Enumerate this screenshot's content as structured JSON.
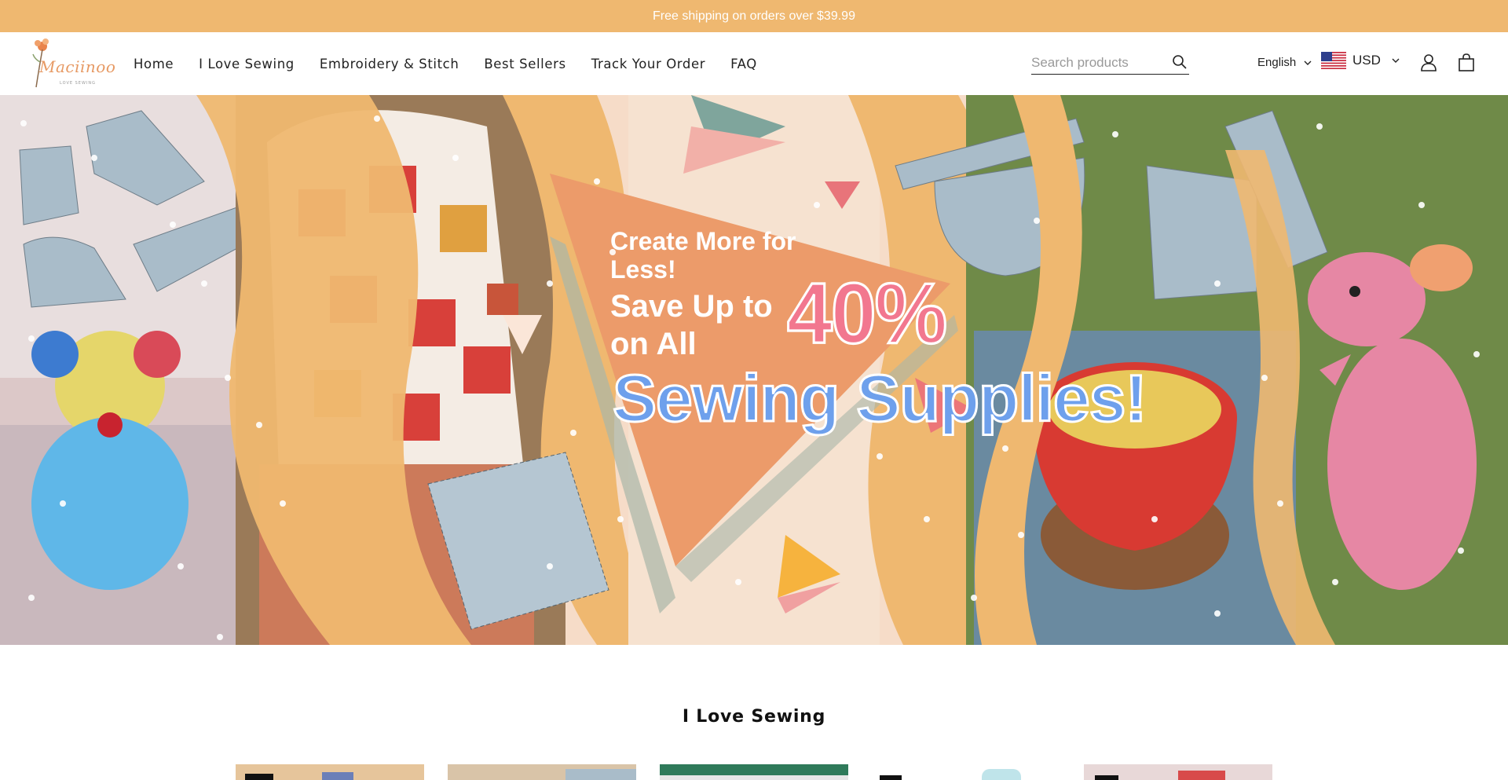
{
  "announcement": {
    "text": "Free shipping on orders over $39.99"
  },
  "header": {
    "logo": {
      "name": "Maciinoo",
      "tagline": "LOVE SEWING"
    },
    "nav": [
      {
        "label": "Home"
      },
      {
        "label": "I Love Sewing"
      },
      {
        "label": "Embroidery & Stitch"
      },
      {
        "label": "Best Sellers"
      },
      {
        "label": "Track Your Order"
      },
      {
        "label": "FAQ"
      }
    ],
    "search": {
      "placeholder": "Search products",
      "value": ""
    },
    "language": "English",
    "currency": "USD"
  },
  "hero": {
    "line1": "Create More for Less!",
    "line2": "Save Up to on All",
    "percent": "40%",
    "line3": "Sewing Supplies!",
    "colors": {
      "orange": "#efb870",
      "pink": "#f2778f",
      "blue": "#6ea0ec",
      "cream": "#f6dcc8",
      "triangle": "#ec9b6a"
    }
  },
  "section": {
    "title": "I Love Sewing"
  },
  "colors": {
    "accent": "#efb870",
    "text": "#222222"
  }
}
